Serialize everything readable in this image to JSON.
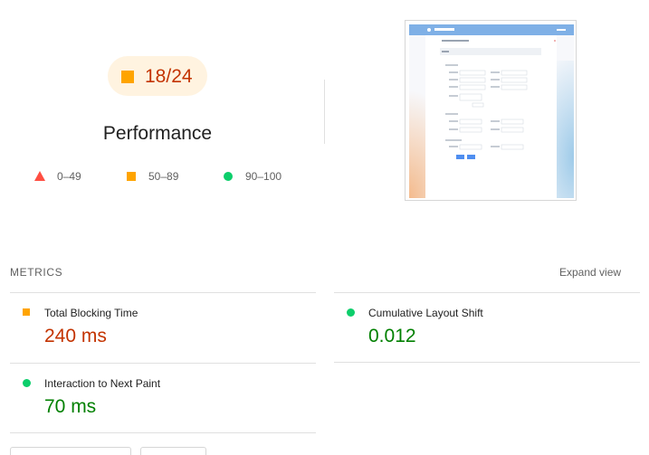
{
  "gauge": {
    "score_text": "18/24",
    "title": "Performance"
  },
  "legend": {
    "fail": "0–49",
    "average": "50–89",
    "pass": "90–100"
  },
  "colors": {
    "fail": "#ff4e42",
    "average": "#ffa400",
    "pass": "#0cce6b",
    "average_text": "#c33300",
    "pass_text": "#008000"
  },
  "metrics": {
    "header": "METRICS",
    "expand_label": "Expand view",
    "items": [
      {
        "title": "Total Blocking Time",
        "value": "240 ms",
        "rating": "average"
      },
      {
        "title": "Cumulative Layout Shift",
        "value": "0.012",
        "rating": "pass"
      },
      {
        "title": "Interaction to Next Paint",
        "value": "70 ms",
        "rating": "pass"
      }
    ]
  }
}
